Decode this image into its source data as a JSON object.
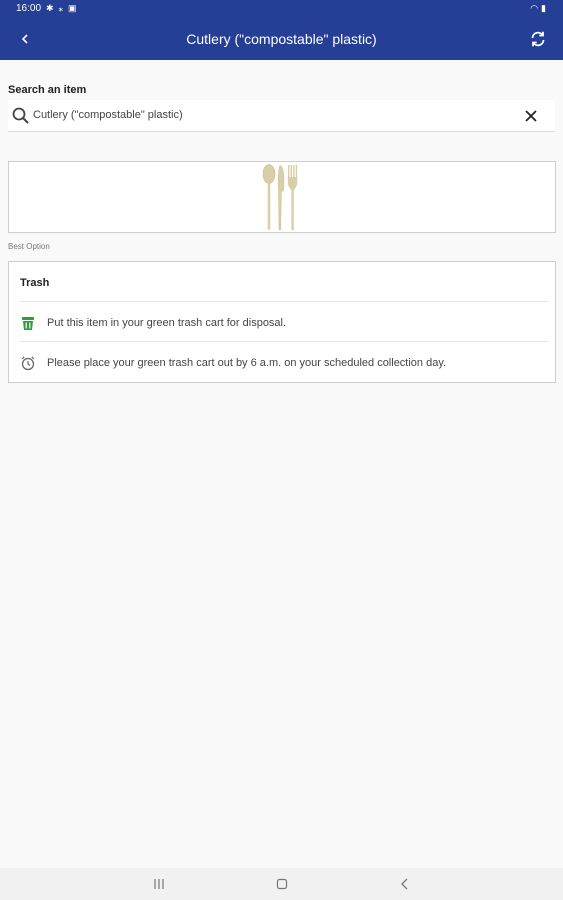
{
  "status_bar": {
    "time": "16:00"
  },
  "app_bar": {
    "title": "Cutlery (\"compostable\" plastic)",
    "back_icon": "chevron-left-icon",
    "refresh_icon": "refresh-icon"
  },
  "search": {
    "label": "Search an item",
    "value": "Cutlery (\"compostable\" plastic)"
  },
  "result": {
    "best_option_label": "Best Option",
    "title": "Trash",
    "rows": [
      {
        "icon": "trash-cart-icon",
        "text": "Put this item in your green trash cart for disposal."
      },
      {
        "icon": "alarm-clock-icon",
        "text": "Please place your green trash cart out by 6 a.m. on your scheduled collection day."
      }
    ]
  },
  "colors": {
    "header_bg": "#243f95",
    "trash_green": "#2e9e3a"
  }
}
